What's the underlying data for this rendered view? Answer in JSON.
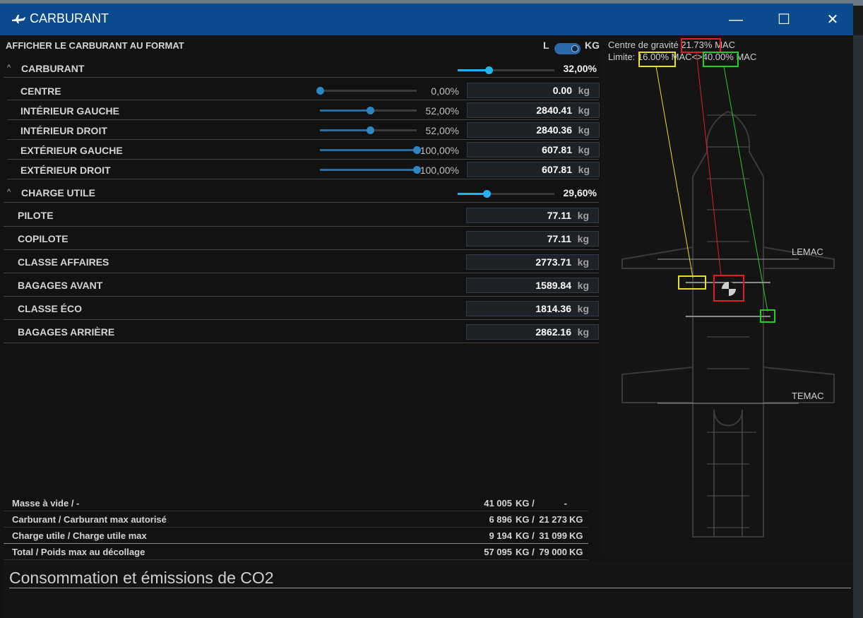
{
  "window": {
    "title": "CARBURANT",
    "controls": {
      "minimize": "—",
      "maximize": "☐",
      "close": "✕"
    }
  },
  "format": {
    "label": "AFFICHER LE CARBURANT AU FORMAT",
    "left_option": "L",
    "right_option": "KG",
    "selected": "KG"
  },
  "fuel": {
    "header": "CARBURANT",
    "chevron": "^",
    "slider_fraction": 0.32,
    "percent": "32,00%",
    "tanks": [
      {
        "label": "CENTRE",
        "fraction": 0.0,
        "percent": "0,00%",
        "value": "0.00",
        "unit": "kg"
      },
      {
        "label": "INTÉRIEUR GAUCHE",
        "fraction": 0.52,
        "percent": "52,00%",
        "value": "2840.41",
        "unit": "kg"
      },
      {
        "label": "INTÉRIEUR DROIT",
        "fraction": 0.52,
        "percent": "52,00%",
        "value": "2840.36",
        "unit": "kg"
      },
      {
        "label": "EXTÉRIEUR GAUCHE",
        "fraction": 1.0,
        "percent": "100,00%",
        "value": "607.81",
        "unit": "kg"
      },
      {
        "label": "EXTÉRIEUR DROIT",
        "fraction": 1.0,
        "percent": "100,00%",
        "value": "607.81",
        "unit": "kg"
      }
    ]
  },
  "payload": {
    "header": "CHARGE UTILE",
    "chevron": "^",
    "slider_fraction": 0.296,
    "percent": "29,60%",
    "stations": [
      {
        "label": "PILOTE",
        "value": "77.11",
        "unit": "kg"
      },
      {
        "label": "COPILOTE",
        "value": "77.11",
        "unit": "kg"
      },
      {
        "label": "CLASSE AFFAIRES",
        "value": "2773.71",
        "unit": "kg"
      },
      {
        "label": "BAGAGES AVANT",
        "value": "1589.84",
        "unit": "kg"
      },
      {
        "label": "CLASSE ÉCO",
        "value": "1814.36",
        "unit": "kg"
      },
      {
        "label": "BAGAGES ARRIÈRE",
        "value": "2862.16",
        "unit": "kg"
      }
    ]
  },
  "summary": [
    {
      "label": "Masse à vide / -",
      "v1": "41 005",
      "u1": "KG /",
      "v2": "-",
      "u2": ""
    },
    {
      "label": "Carburant / Carburant max autorisé",
      "v1": "6 896",
      "u1": "KG /",
      "v2": "21 273",
      "u2": "KG"
    },
    {
      "label": "Charge utile / Charge utile max",
      "v1": "9 194",
      "u1": "KG /",
      "v2": "31 099",
      "u2": "KG"
    },
    {
      "label": "Total / Poids max au décollage",
      "v1": "57 095",
      "u1": "KG /",
      "v2": "79 000",
      "u2": "KG"
    }
  ],
  "cg": {
    "title_prefix": "Centre de gravité",
    "cg_value": "21.73%",
    "mac": "MAC",
    "limit_prefix": "Limite:",
    "limit_min": "16.00%",
    "limit_mid": "MAC<>",
    "limit_max": "40.00%",
    "limit_suffix": "MAC",
    "lemac": "LEMAC",
    "temac": "TEMAC",
    "colors": {
      "cg": "#e02020",
      "min": "#e8e020",
      "max": "#20d020"
    }
  },
  "co2": {
    "title": "Consommation et émissions de CO2"
  },
  "colors": {
    "accent": "#1fb6ee",
    "titlebar": "#0b4a8c",
    "slider_dim": "#2a6da0"
  }
}
